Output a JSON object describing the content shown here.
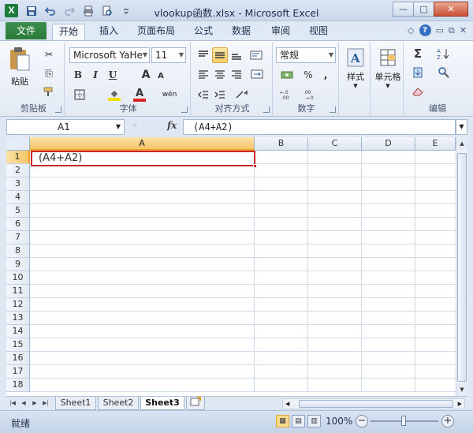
{
  "window": {
    "title": "vlookup函数.xlsx - Microsoft Excel",
    "app_icon_letter": "X",
    "minimize": "—",
    "maximize": "□",
    "close": "✕"
  },
  "ribbon_tabs": {
    "file": "文件",
    "items": [
      "开始",
      "插入",
      "页面布局",
      "公式",
      "数据",
      "审阅",
      "视图"
    ],
    "active": "开始"
  },
  "ribbon": {
    "clipboard": {
      "label": "剪贴板",
      "paste": "粘贴"
    },
    "font": {
      "label": "字体",
      "font_name": "Microsoft YaHe",
      "font_size": "11",
      "bold": "B",
      "italic": "I",
      "underline": "U",
      "grow": "A",
      "shrink": "A",
      "fill_glyph": "◆",
      "color_glyph": "A",
      "phonetic": "wén"
    },
    "alignment": {
      "label": "对齐方式"
    },
    "number": {
      "label": "数字",
      "format": "常规",
      "percent": "%",
      "comma": ","
    },
    "styles": {
      "label": "样式"
    },
    "cells": {
      "label": "单元格"
    },
    "editing": {
      "label": "编辑",
      "sum": "Σ"
    }
  },
  "formula_bar": {
    "name_box": "A1",
    "fx": "fx",
    "formula": "(A4+A2)"
  },
  "grid": {
    "columns": [
      "A",
      "B",
      "C",
      "D",
      "E"
    ],
    "active_column": "A",
    "rows": [
      "1",
      "2",
      "3",
      "4",
      "5",
      "6",
      "7",
      "8",
      "9",
      "10",
      "11",
      "12",
      "13",
      "14",
      "15",
      "16",
      "17",
      "18"
    ],
    "active_row": "1",
    "cell_a1": "(A4+A2)"
  },
  "sheets": {
    "tabs": [
      "Sheet1",
      "Sheet2",
      "Sheet3"
    ],
    "active": "Sheet3"
  },
  "status": {
    "ready": "就绪",
    "zoom": "100%",
    "zoom_minus": "−",
    "zoom_plus": "+"
  },
  "colors": {
    "accent_green": "#2b7a3c",
    "active_cell_border": "#c8282a",
    "header_highlight": "#f5c566"
  }
}
